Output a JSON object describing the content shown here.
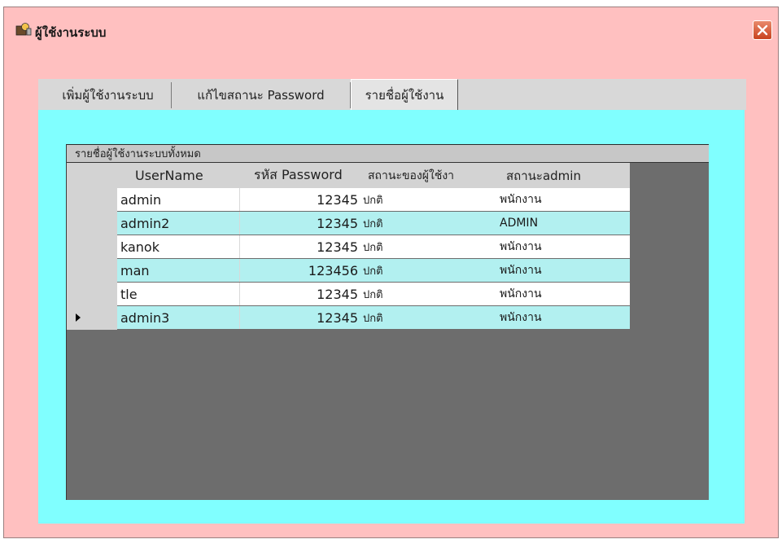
{
  "window": {
    "title": "ผู้ใช้งานระบบ"
  },
  "tabs": [
    {
      "label": "เพิ่มผู้ใช้งานระบบ",
      "active": false
    },
    {
      "label": "แก้ไขสถานะ Password",
      "active": false
    },
    {
      "label": "รายชื่อผู้ใช้งาน",
      "active": true
    }
  ],
  "grid": {
    "caption": "รายชื่อผู้ใช้งานระบบทั้งหมด",
    "columns": [
      "UserName",
      "รหัส Password",
      "สถานะของผู้ใช้งา",
      "สถานะadmin"
    ],
    "rows": [
      {
        "username": "admin",
        "password": "12345",
        "status": "ปกติ",
        "admin": "พนักงาน"
      },
      {
        "username": "admin2",
        "password": "12345",
        "status": "ปกติ",
        "admin": "ADMIN"
      },
      {
        "username": "kanok",
        "password": "12345",
        "status": "ปกติ",
        "admin": "พนักงาน"
      },
      {
        "username": "man",
        "password": "123456",
        "status": "ปกติ",
        "admin": "พนักงาน"
      },
      {
        "username": "tle",
        "password": "12345",
        "status": "ปกติ",
        "admin": "พนักงาน"
      },
      {
        "username": "admin3",
        "password": "12345",
        "status": "ปกติ",
        "admin": "พนักงาน"
      }
    ],
    "current_row": 6,
    "row_colors": [
      "#ffffff",
      "#b2f0f0"
    ]
  },
  "colors": {
    "window_bg": "#ffc0c0",
    "panel_bg": "#80ffff",
    "grid_bg": "#6d6d6d",
    "close_button": "#d9542e"
  }
}
